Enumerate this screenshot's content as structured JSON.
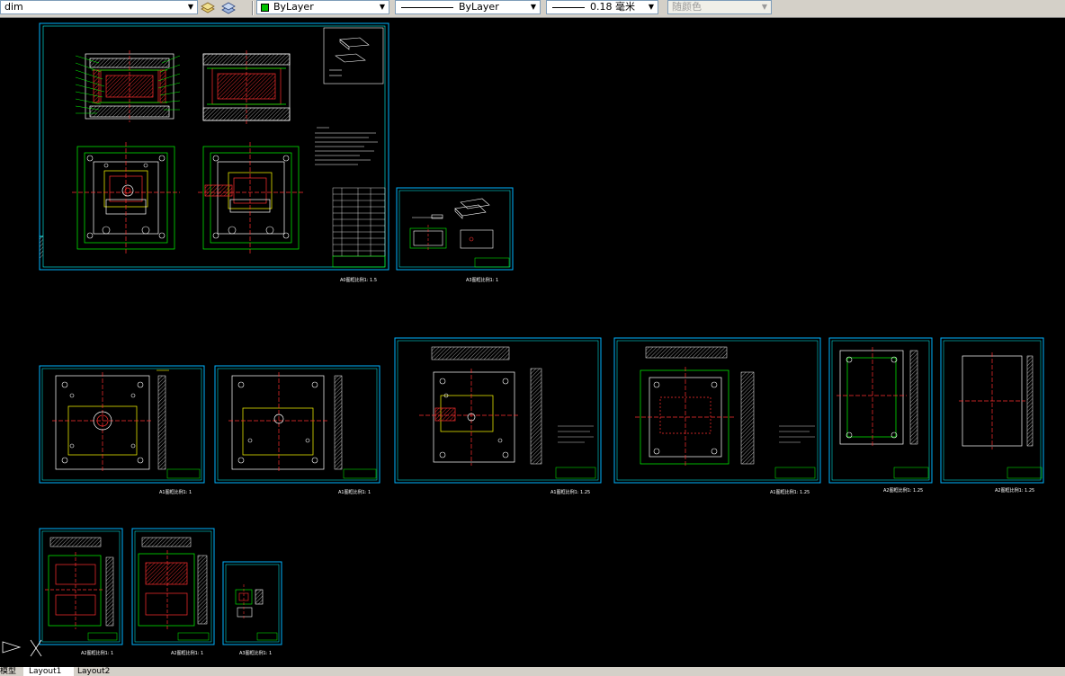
{
  "toolbar": {
    "layer_combo": "dim",
    "color_combo": "ByLayer",
    "linetype_combo": "ByLayer",
    "lineweight_combo": "0.18 毫米",
    "plotstyle_combo": "随颜色",
    "colors": {
      "bylayer_swatch": "#00c000"
    }
  },
  "layouts": [
    {
      "caption": "A0图框比例1: 1.5"
    },
    {
      "caption": "A3图框比例1: 1"
    },
    {
      "caption": "A1图框比例1: 1"
    },
    {
      "caption": "A1图框比例1: 1"
    },
    {
      "caption": "A1图框比例1: 1.25"
    },
    {
      "caption": "A1图框比例1: 1.25"
    },
    {
      "caption": "A2图框比例1: 1.25"
    },
    {
      "caption": "A2图框比例1: 1.25"
    },
    {
      "caption": "A2图框比例1: 1"
    },
    {
      "caption": "A2图框比例1: 1"
    },
    {
      "caption": "A3图框比例1: 1"
    }
  ],
  "tabs": {
    "model": "模型",
    "layout1": "Layout1",
    "layout2": "Layout2"
  },
  "colors": {
    "background": "#000000",
    "frame": "#00b4ff",
    "cyan": "#00ffff",
    "green": "#00ff00",
    "red": "#ff2020",
    "yellow": "#ffff00",
    "white": "#ffffff",
    "magenta": "#ff00ff"
  }
}
